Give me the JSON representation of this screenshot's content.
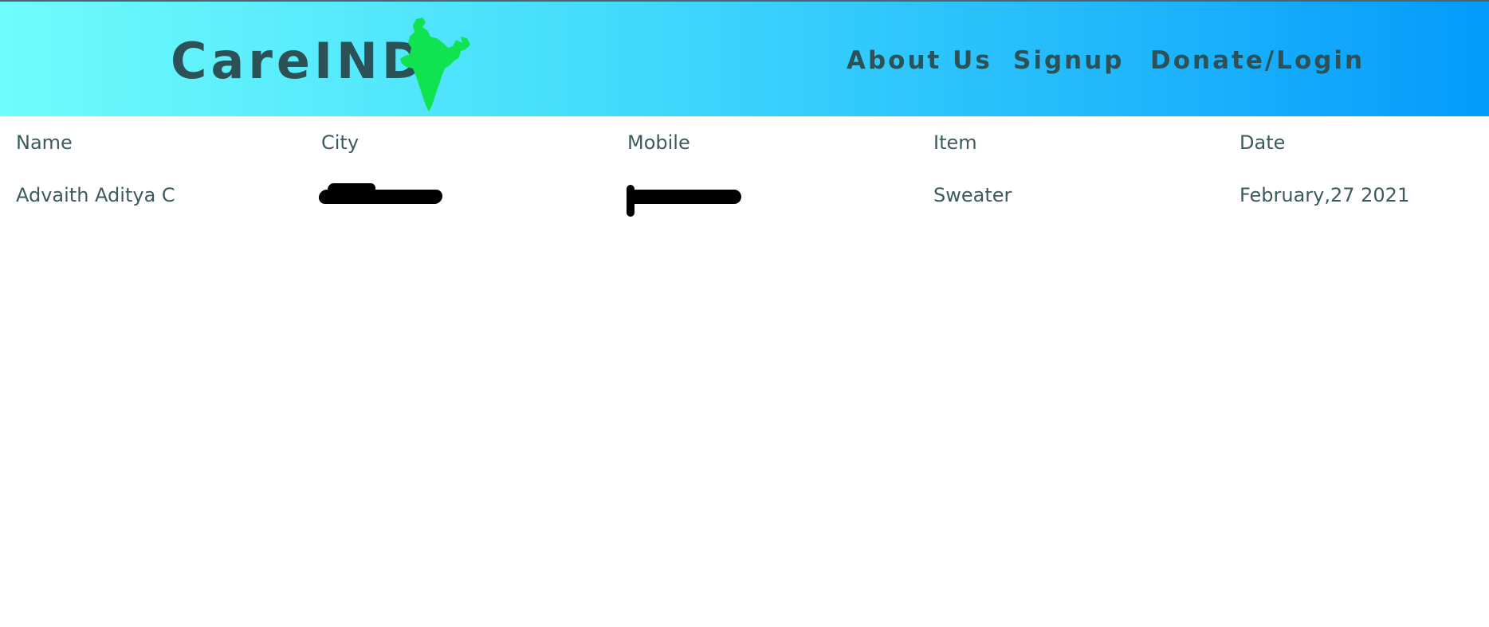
{
  "header": {
    "brand": "CareIND",
    "map_icon": "india-map-icon",
    "map_color": "#0fe34f",
    "nav": {
      "about": "About Us",
      "signup": "Signup",
      "donate_login": "Donate/Login"
    },
    "gradient_start": "#6ffcfc",
    "gradient_end": "#039bfc",
    "text_color": "#2c5156"
  },
  "table": {
    "columns": [
      "Name",
      "City",
      "Mobile",
      "Item",
      "Date"
    ],
    "rows": [
      {
        "name": "Advaith Aditya C",
        "city": "[redacted]",
        "mobile": "[redacted]",
        "item": "Sweater",
        "date": "February,27 2021"
      }
    ]
  }
}
